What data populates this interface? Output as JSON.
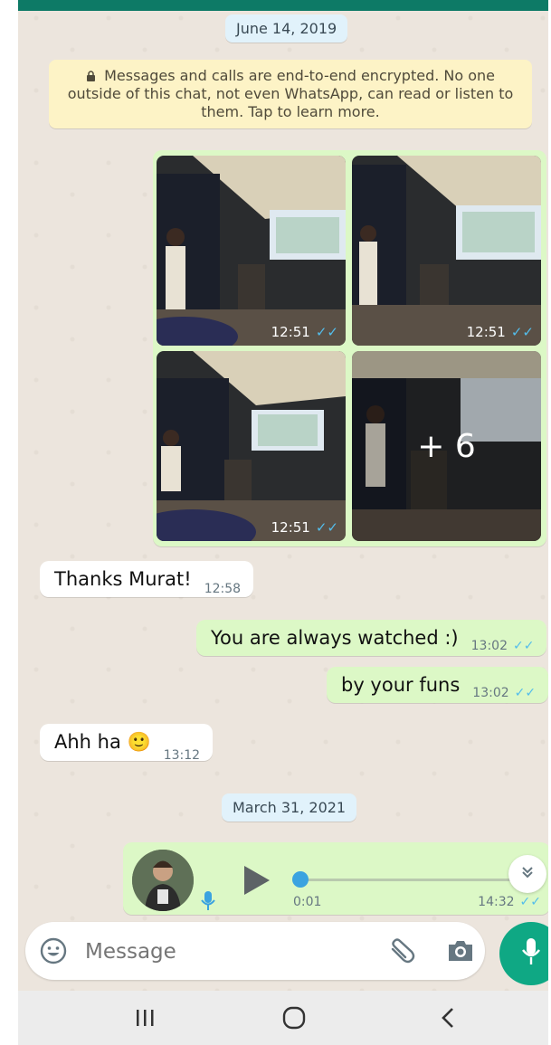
{
  "date_dividers": [
    "June 14, 2019",
    "March 31, 2021"
  ],
  "encryption_notice": "Messages and calls are end-to-end encrypted. No one outside of this chat, not even WhatsApp, can read or listen to them. Tap to learn more.",
  "media_album": {
    "photos": [
      {
        "time": "12:51"
      },
      {
        "time": "12:51"
      },
      {
        "time": "12:51"
      }
    ],
    "more_count": "+ 6"
  },
  "messages": [
    {
      "direction": "incoming",
      "text": "Thanks Murat!",
      "time": "12:58"
    },
    {
      "direction": "outgoing",
      "text": "You are always watched :)",
      "time": "13:02"
    },
    {
      "direction": "outgoing",
      "text": "by your funs",
      "time": "13:02"
    },
    {
      "direction": "incoming",
      "text": "Ahh ha",
      "time": "13:12",
      "emoji": "🙂"
    }
  ],
  "voice_message": {
    "duration": "0:01",
    "time": "14:32",
    "progress": 0
  },
  "composer": {
    "placeholder": "Message"
  },
  "colors": {
    "outgoing_bubble": "#dcf8c6",
    "incoming_bubble": "#ffffff",
    "accent": "#0fa884",
    "read_ticks": "#53bdeb"
  },
  "icons": [
    "lock-icon",
    "emoji-icon",
    "attach-icon",
    "camera-icon",
    "mic-icon",
    "play-icon",
    "scroll-down-icon",
    "recents-nav-icon",
    "home-nav-icon",
    "back-nav-icon"
  ]
}
